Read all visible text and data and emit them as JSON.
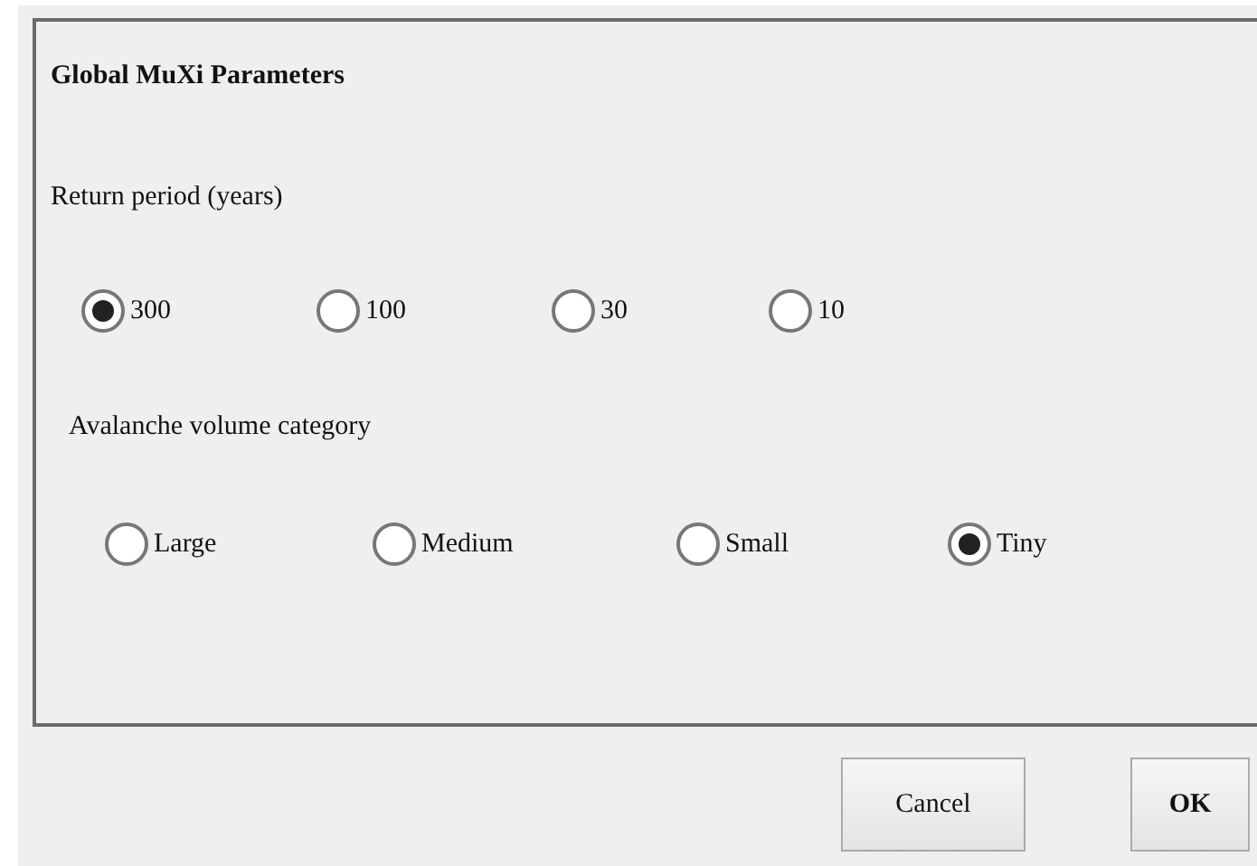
{
  "dialog": {
    "title": "Global MuXi Parameters",
    "groups": [
      {
        "label": "Return period (years)",
        "options": [
          {
            "label": "300",
            "selected": true
          },
          {
            "label": "100",
            "selected": false
          },
          {
            "label": "30",
            "selected": false
          },
          {
            "label": "10",
            "selected": false
          }
        ]
      },
      {
        "label": "Avalanche volume category",
        "options": [
          {
            "label": "Large",
            "selected": false
          },
          {
            "label": "Medium",
            "selected": false
          },
          {
            "label": "Small",
            "selected": false
          },
          {
            "label": "Tiny",
            "selected": true
          }
        ]
      }
    ]
  },
  "buttons": [
    {
      "label": "Cancel",
      "kind": "normal"
    },
    {
      "label": "OK",
      "kind": "default"
    }
  ]
}
